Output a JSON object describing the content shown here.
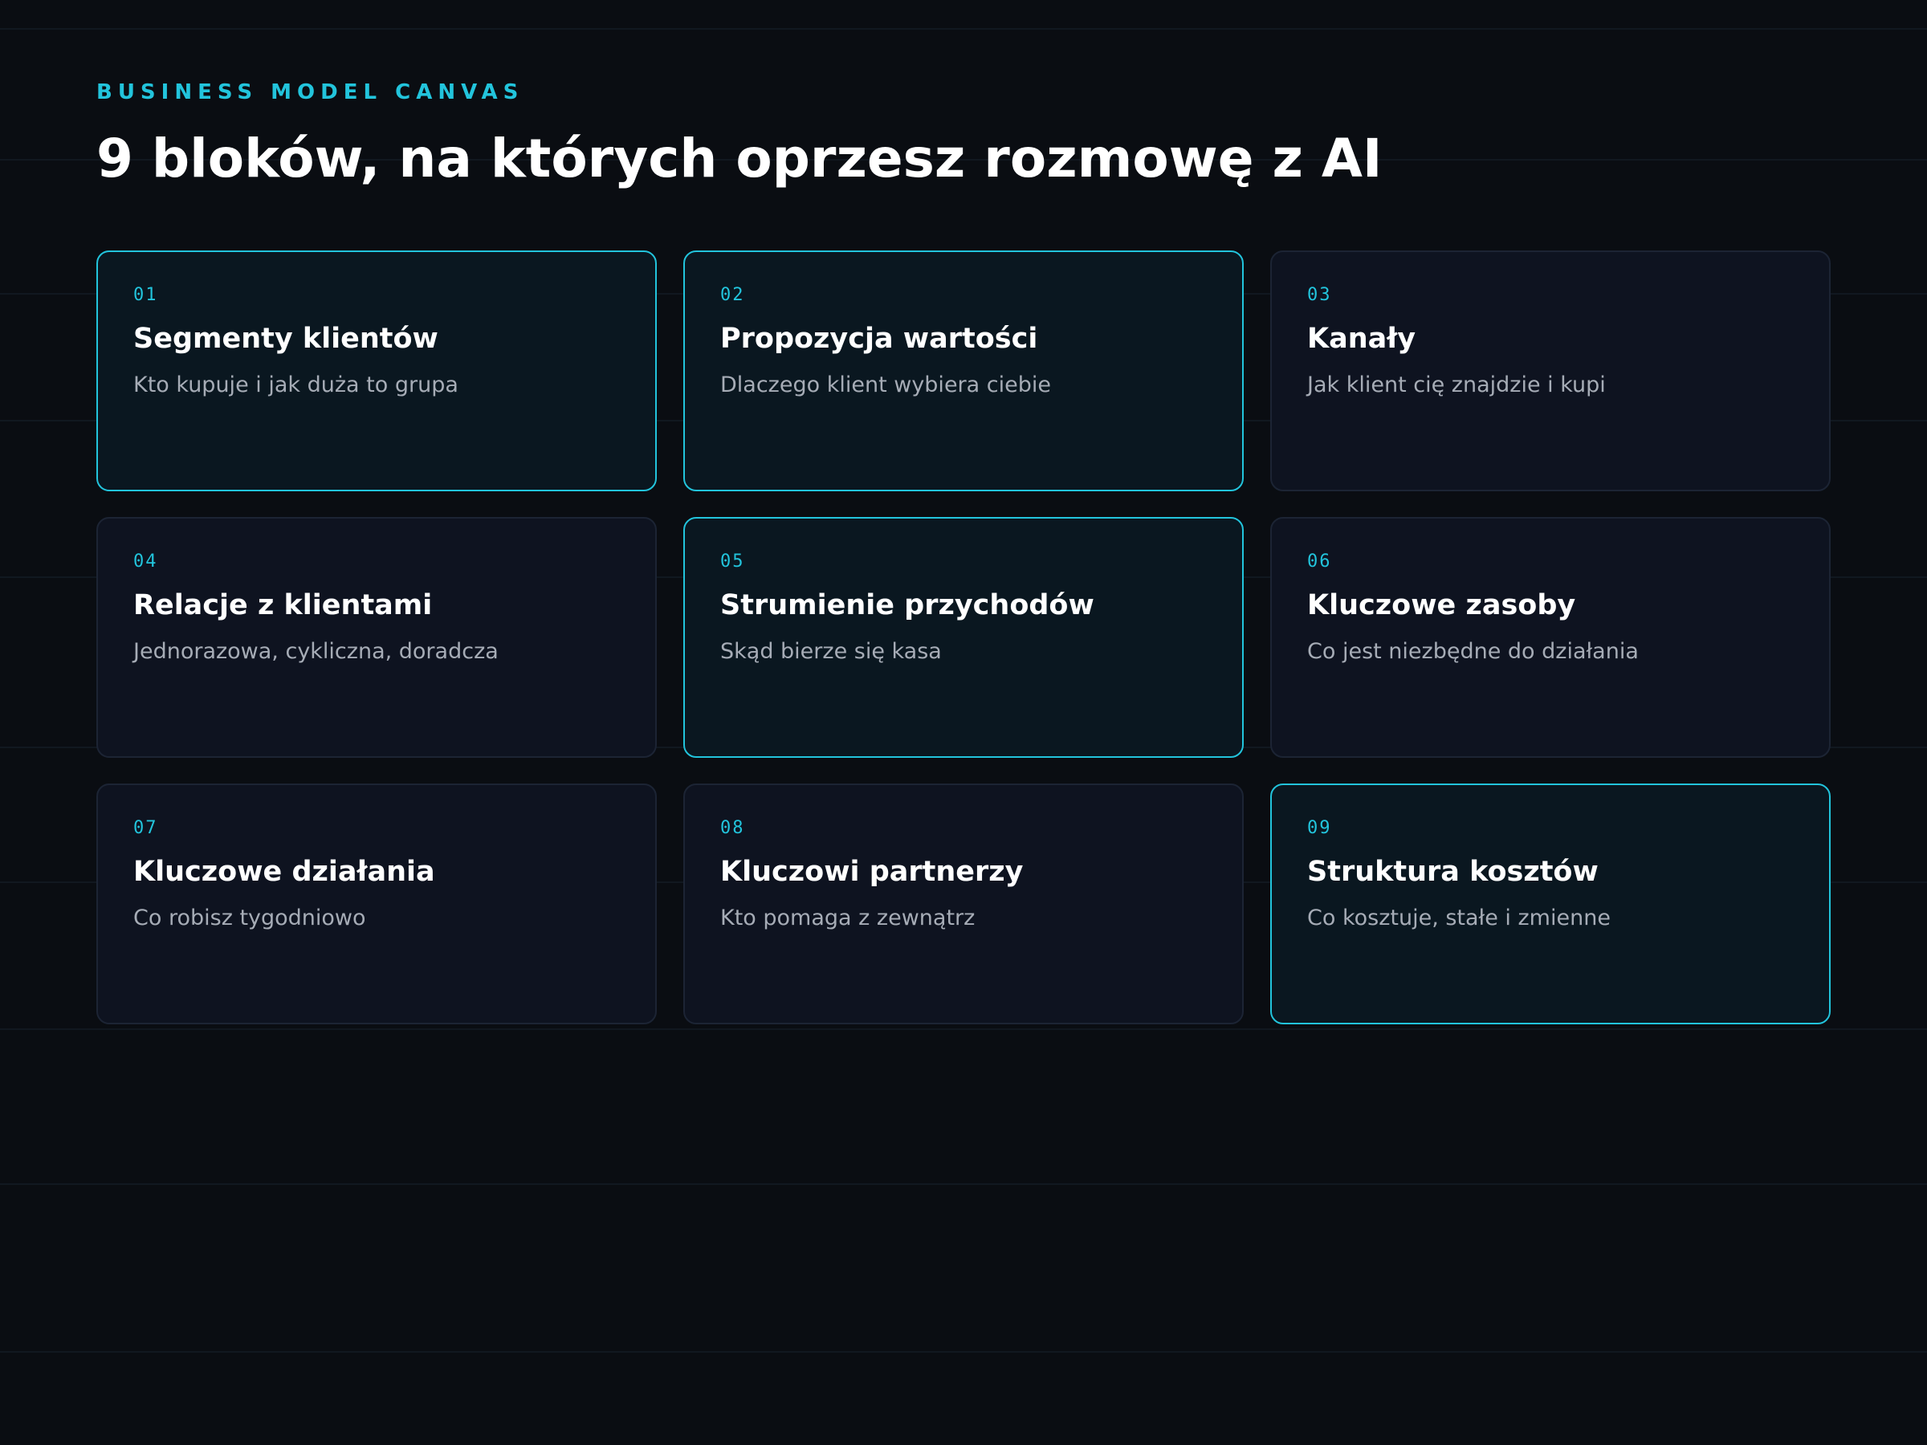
{
  "header": {
    "eyebrow": "BUSINESS MODEL CANVAS",
    "title": "9 bloków, na których oprzesz rozmowę z AI"
  },
  "accent_color": "#22c4dc",
  "blocks": [
    {
      "num": "01",
      "title": "Segmenty klientów",
      "desc": "Kto kupuje i jak duża to grupa",
      "highlighted": true
    },
    {
      "num": "02",
      "title": "Propozycja wartości",
      "desc": "Dlaczego klient wybiera ciebie",
      "highlighted": true
    },
    {
      "num": "03",
      "title": "Kanały",
      "desc": "Jak klient cię znajdzie i kupi",
      "highlighted": false
    },
    {
      "num": "04",
      "title": "Relacje z klientami",
      "desc": "Jednorazowa, cykliczna, doradcza",
      "highlighted": false
    },
    {
      "num": "05",
      "title": "Strumienie przychodów",
      "desc": "Skąd bierze się kasa",
      "highlighted": true
    },
    {
      "num": "06",
      "title": "Kluczowe zasoby",
      "desc": "Co jest niezbędne do działania",
      "highlighted": false
    },
    {
      "num": "07",
      "title": "Kluczowe działania",
      "desc": "Co robisz tygodniowo",
      "highlighted": false
    },
    {
      "num": "08",
      "title": "Kluczowi partnerzy",
      "desc": "Kto pomaga z zewnątrz",
      "highlighted": false
    },
    {
      "num": "09",
      "title": "Struktura kosztów",
      "desc": "Co kosztuje, stałe i zmienne",
      "highlighted": true
    }
  ]
}
